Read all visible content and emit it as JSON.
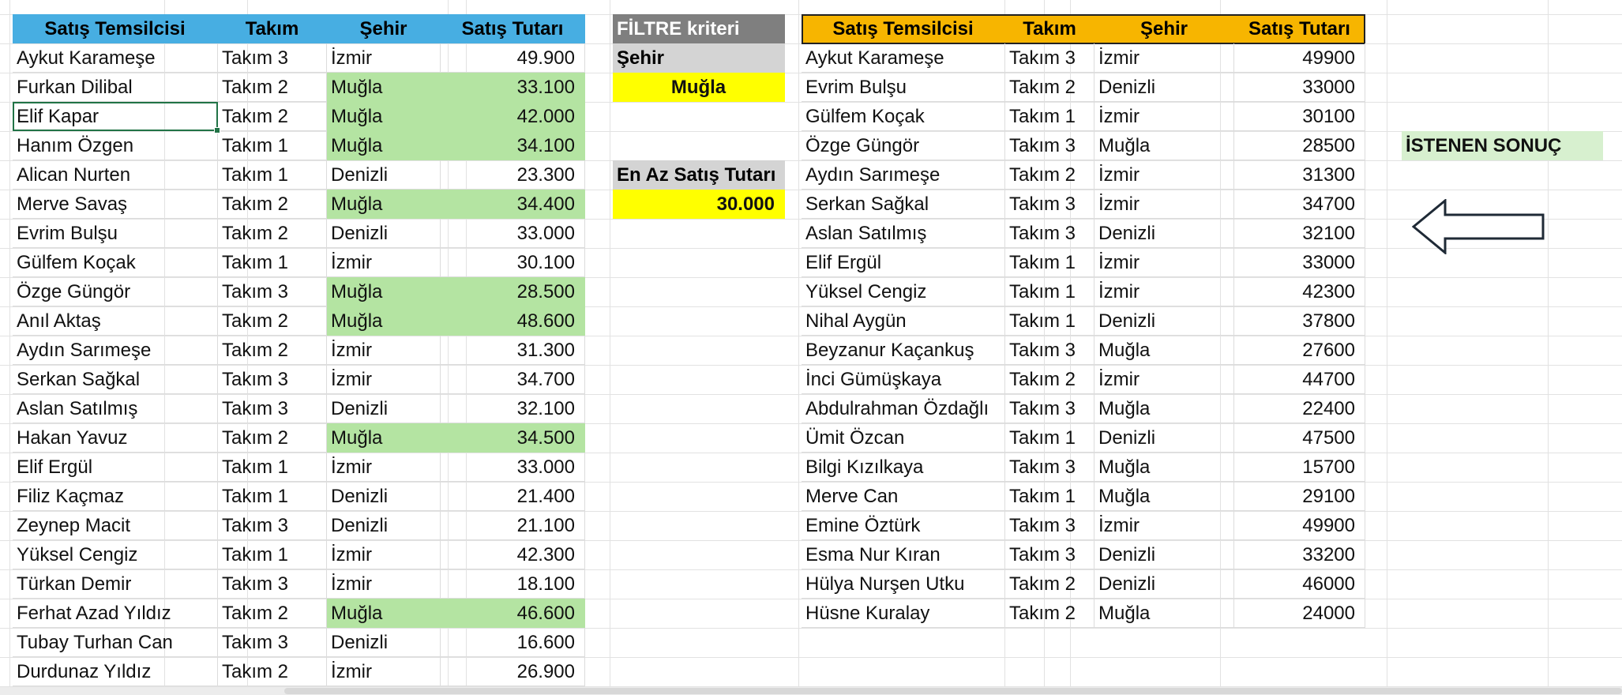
{
  "left_table": {
    "headers": [
      "Satış Temsilcisi",
      "Takım",
      "Şehir",
      "Satış Tutarı"
    ],
    "rows": [
      [
        "Aykut Karameşe",
        "Takım 3",
        "İzmir",
        "49.900"
      ],
      [
        "Furkan Dilibal",
        "Takım 2",
        "Muğla",
        "33.100"
      ],
      [
        "Elif Kapar",
        "Takım 2",
        "Muğla",
        "42.000"
      ],
      [
        "Hanım Özgen",
        "Takım 1",
        "Muğla",
        "34.100"
      ],
      [
        "Alican Nurten",
        "Takım 1",
        "Denizli",
        "23.300"
      ],
      [
        "Merve Savaş",
        "Takım 2",
        "Muğla",
        "34.400"
      ],
      [
        "Evrim Bulşu",
        "Takım 2",
        "Denizli",
        "33.000"
      ],
      [
        "Gülfem Koçak",
        "Takım 1",
        "İzmir",
        "30.100"
      ],
      [
        "Özge Güngör",
        "Takım 3",
        "Muğla",
        "28.500"
      ],
      [
        "Anıl Aktaş",
        "Takım 2",
        "Muğla",
        "48.600"
      ],
      [
        "Aydın Sarımeşe",
        "Takım 2",
        "İzmir",
        "31.300"
      ],
      [
        "Serkan Sağkal",
        "Takım 3",
        "İzmir",
        "34.700"
      ],
      [
        "Aslan Satılmış",
        "Takım 3",
        "Denizli",
        "32.100"
      ],
      [
        "Hakan Yavuz",
        "Takım 2",
        "Muğla",
        "34.500"
      ],
      [
        "Elif Ergül",
        "Takım 1",
        "İzmir",
        "33.000"
      ],
      [
        "Filiz Kaçmaz",
        "Takım 1",
        "Denizli",
        "21.400"
      ],
      [
        "Zeynep Macit",
        "Takım 3",
        "Denizli",
        "21.100"
      ],
      [
        "Yüksel Cengiz",
        "Takım 1",
        "İzmir",
        "42.300"
      ],
      [
        "Türkan Demir",
        "Takım 3",
        "İzmir",
        "18.100"
      ],
      [
        "Ferhat Azad Yıldız",
        "Takım 2",
        "Muğla",
        "46.600"
      ],
      [
        "Tubay Turhan Can",
        "Takım 3",
        "Denizli",
        "16.600"
      ],
      [
        "Durdunaz Yıldız",
        "Takım 2",
        "İzmir",
        "26.900"
      ]
    ],
    "highlight_color": "#b4e4a2",
    "header_color": "#47aee2"
  },
  "filter": {
    "title": "FİLTRE kriteri",
    "city_label": "Şehir",
    "city_value": "Muğla",
    "min_label": "En Az Satış Tutarı",
    "min_value": "30.000",
    "value_color": "#ffff00"
  },
  "right_table": {
    "headers": [
      "Satış Temsilcisi",
      "Takım",
      "Şehir",
      "Satış Tutarı"
    ],
    "rows": [
      [
        "Aykut Karameşe",
        "Takım 3",
        "İzmir",
        "49900"
      ],
      [
        "Evrim Bulşu",
        "Takım 2",
        "Denizli",
        "33000"
      ],
      [
        "Gülfem Koçak",
        "Takım 1",
        "İzmir",
        "30100"
      ],
      [
        "Özge Güngör",
        "Takım 3",
        "Muğla",
        "28500"
      ],
      [
        "Aydın Sarımeşe",
        "Takım 2",
        "İzmir",
        "31300"
      ],
      [
        "Serkan Sağkal",
        "Takım 3",
        "İzmir",
        "34700"
      ],
      [
        "Aslan Satılmış",
        "Takım 3",
        "Denizli",
        "32100"
      ],
      [
        "Elif Ergül",
        "Takım 1",
        "İzmir",
        "33000"
      ],
      [
        "Yüksel Cengiz",
        "Takım 1",
        "İzmir",
        "42300"
      ],
      [
        "Nihal Aygün",
        "Takım 1",
        "Denizli",
        "37800"
      ],
      [
        "Beyzanur Kaçankuş",
        "Takım 3",
        "Muğla",
        "27600"
      ],
      [
        "İnci Gümüşkaya",
        "Takım 2",
        "İzmir",
        "44700"
      ],
      [
        "Abdulrahman Özdağlı",
        "Takım 3",
        "Muğla",
        "22400"
      ],
      [
        "Ümit Özcan",
        "Takım 1",
        "Denizli",
        "47500"
      ],
      [
        "Bilgi Kızılkaya",
        "Takım 3",
        "Muğla",
        "15700"
      ],
      [
        "Merve Can",
        "Takım 1",
        "Muğla",
        "29100"
      ],
      [
        "Emine Öztürk",
        "Takım 3",
        "İzmir",
        "49900"
      ],
      [
        "Esma Nur Kıran",
        "Takım 3",
        "Denizli",
        "33200"
      ],
      [
        "Hülya Nurşen Utku",
        "Takım 2",
        "Denizli",
        "46000"
      ],
      [
        "Hüsne Kuralay",
        "Takım 2",
        "Muğla",
        "24000"
      ]
    ],
    "header_color": "#f7b500"
  },
  "result": {
    "label": "İSTENEN SONUÇ",
    "arrow_icon": "left-arrow-icon"
  }
}
